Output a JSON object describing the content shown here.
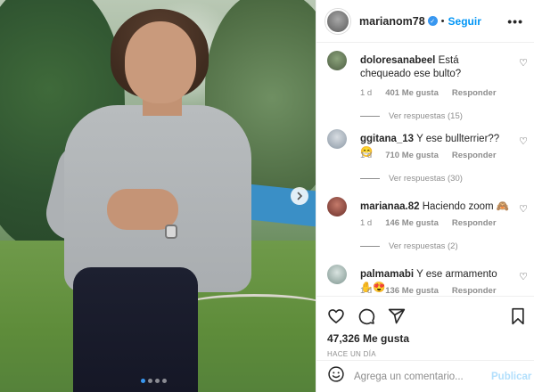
{
  "post": {
    "username": "marianom78",
    "follow_label": "Seguir",
    "more_label": "•••",
    "likes_count": "47,326 Me gusta",
    "time_ago": "HACE UN DÍA"
  },
  "comments": [
    {
      "username": "doloresanabeel",
      "text": "Está chequeado ese bulto?",
      "time": "1 d",
      "likes": "401 Me gusta",
      "reply": "Responder",
      "view_replies": "Ver respuestas (15)"
    },
    {
      "username": "ggitana_13",
      "text": "Y ese bullterrier?? 😁",
      "time": "1 d",
      "likes": "710 Me gusta",
      "reply": "Responder",
      "view_replies": "Ver respuestas (30)"
    },
    {
      "username": "marianaa.82",
      "text": "Haciendo zoom 🙈",
      "time": "1 d",
      "likes": "146 Me gusta",
      "reply": "Responder",
      "view_replies": "Ver respuestas (2)"
    },
    {
      "username": "palmamabi",
      "text": "Y ese armamento ✋😍",
      "time": "1 d",
      "likes": "136 Me gusta",
      "reply": "Responder"
    }
  ],
  "add_comment": {
    "placeholder": "Agrega un comentario...",
    "publish_label": "Publicar"
  },
  "icons": {
    "like": "heart-icon",
    "comment": "comment-icon",
    "share": "share-icon",
    "save": "bookmark-icon",
    "emoji": "emoji-icon",
    "next": "chevron-right-icon"
  },
  "colors": {
    "accent": "#0095f6",
    "muted": "#8e8e8e",
    "carousel_active": "#3897f0"
  }
}
